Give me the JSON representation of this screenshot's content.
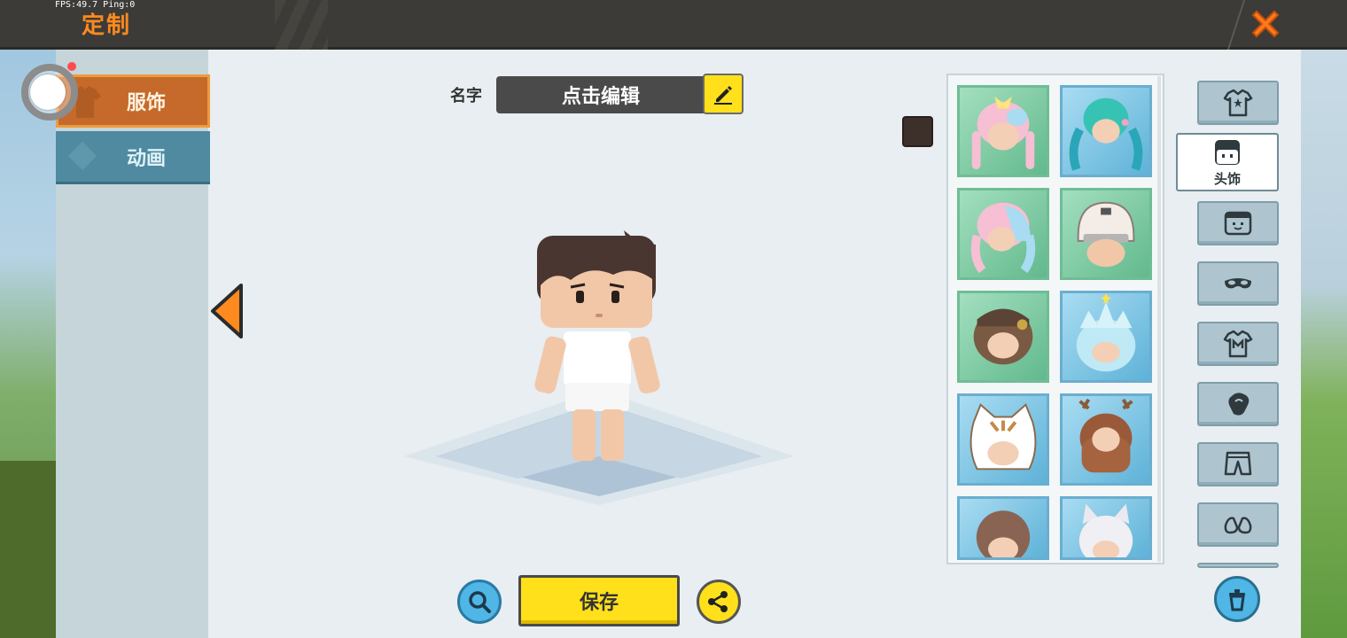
{
  "hud": {
    "fps_text": "FPS:49.7  Ping:0"
  },
  "header": {
    "title": "定制",
    "close_icon": "close-x-icon"
  },
  "sidebar": {
    "tabs": [
      {
        "label": "服饰",
        "active": true
      },
      {
        "label": "动画",
        "active": false
      }
    ]
  },
  "editor": {
    "name_label": "名字",
    "name_value": "点击编辑",
    "edit_icon": "pencil-icon",
    "hair_color": "#3d302b"
  },
  "actions": {
    "zoom_icon": "magnifier-icon",
    "save_label": "保存",
    "share_icon": "share-icon",
    "prev_icon": "arrow-left-icon"
  },
  "items": [
    {
      "name": "pink-twin-braids-hair",
      "tone": "green"
    },
    {
      "name": "teal-twin-tails-hair",
      "tone": "blue"
    },
    {
      "name": "pastel-pink-blue-hair",
      "tone": "green"
    },
    {
      "name": "hockey-helmet",
      "tone": "green"
    },
    {
      "name": "brown-cap-curly-hair",
      "tone": "green"
    },
    {
      "name": "ice-crown-hair",
      "tone": "blue"
    },
    {
      "name": "cat-hood-hat",
      "tone": "blue"
    },
    {
      "name": "antler-long-hair",
      "tone": "blue"
    },
    {
      "name": "brown-bob-hair",
      "tone": "blue"
    },
    {
      "name": "white-cat-ear-hair",
      "tone": "blue"
    }
  ],
  "categories": [
    {
      "name": "full-outfit",
      "icon": "outfit-icon",
      "label": ""
    },
    {
      "name": "headwear",
      "icon": "head-icon",
      "label": "头饰",
      "active": true
    },
    {
      "name": "face",
      "icon": "face-icon",
      "label": ""
    },
    {
      "name": "eyewear",
      "icon": "mask-icon",
      "label": ""
    },
    {
      "name": "top",
      "icon": "shirt-icon",
      "label": ""
    },
    {
      "name": "gloves",
      "icon": "glove-icon",
      "label": ""
    },
    {
      "name": "pants",
      "icon": "pants-icon",
      "label": ""
    },
    {
      "name": "shoes",
      "icon": "shoes-icon",
      "label": ""
    }
  ],
  "colors": {
    "accent_orange": "#ff8a1e",
    "save_yellow": "#ffe01a",
    "tab_active": "#c56a2a",
    "tab_inactive": "#4f8aa0"
  }
}
